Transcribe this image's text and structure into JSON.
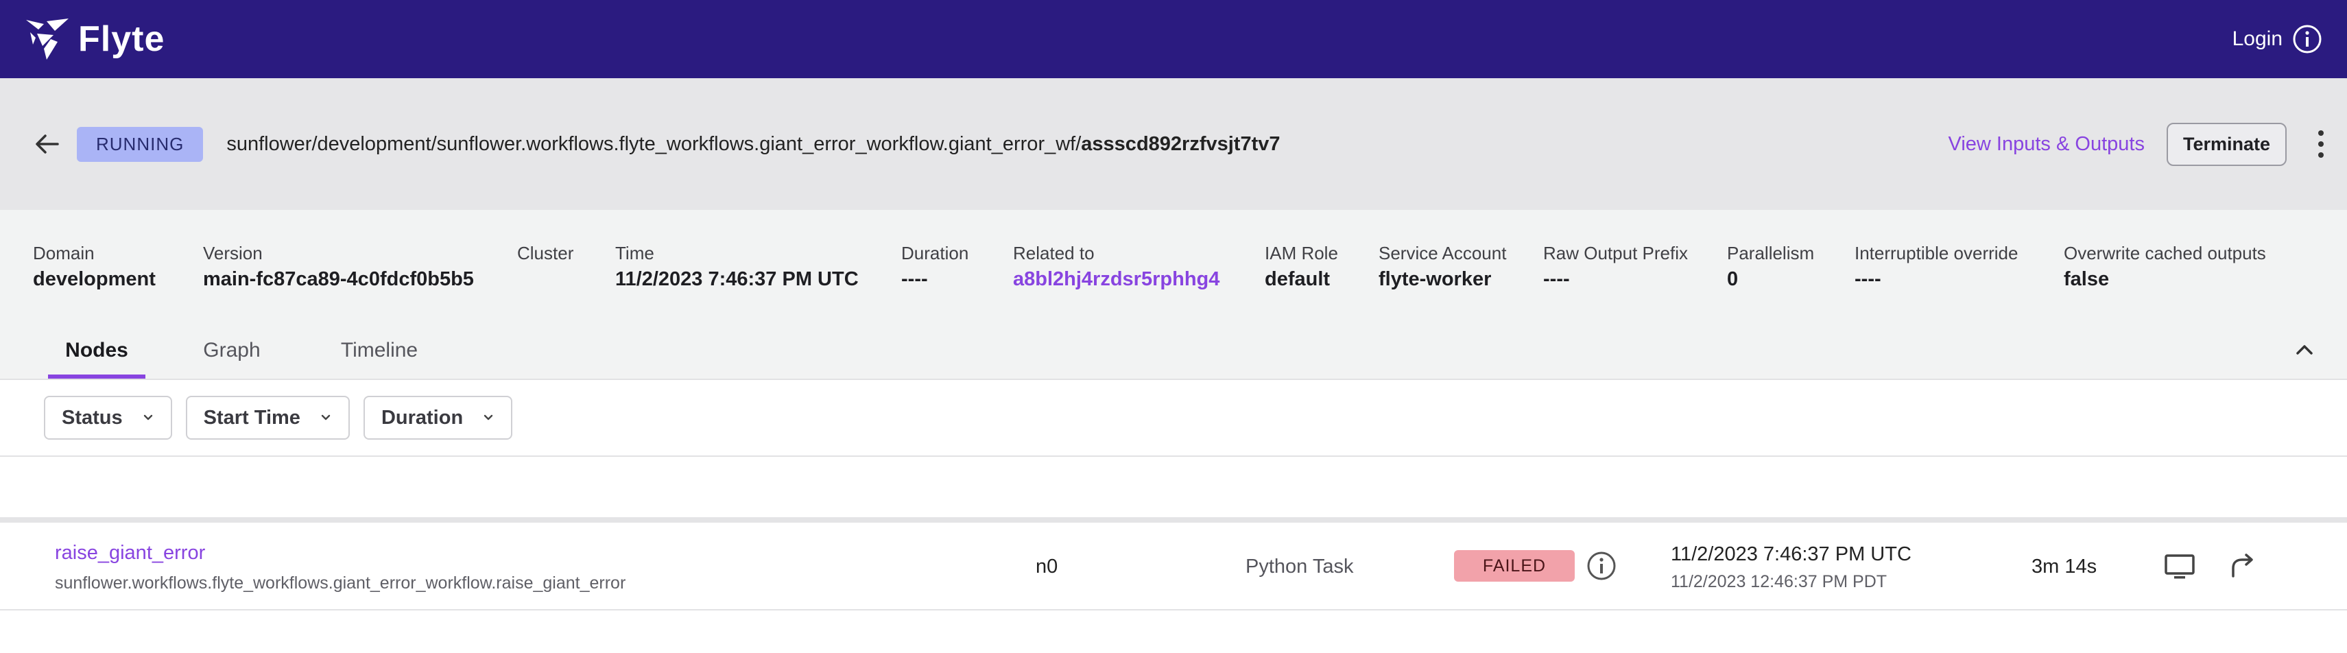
{
  "app": {
    "brand_name": "Flyte",
    "login_label": "Login"
  },
  "execution": {
    "status": "RUNNING",
    "path": "sunflower/development/sunflower.workflows.flyte_workflows.giant_error_workflow.giant_error_wf/",
    "id": "assscd892rzfvsjt7tv7",
    "view_io_label": "View Inputs & Outputs",
    "terminate_label": "Terminate"
  },
  "details": [
    {
      "label": "Domain",
      "value": "development"
    },
    {
      "label": "Version",
      "value": "main-fc87ca89-4c0fdcf0b5b5"
    },
    {
      "label": "Cluster",
      "value": ""
    },
    {
      "label": "Time",
      "value": "11/2/2023 7:46:37 PM UTC"
    },
    {
      "label": "Duration",
      "value": "----"
    },
    {
      "label": "Related to",
      "value": "a8bl2hj4rzdsr5rphhg4"
    },
    {
      "label": "IAM Role",
      "value": "default"
    },
    {
      "label": "Service Account",
      "value": "flyte-worker"
    },
    {
      "label": "Raw Output Prefix",
      "value": "----"
    },
    {
      "label": "Parallelism",
      "value": "0"
    },
    {
      "label": "Interruptible override",
      "value": "----"
    },
    {
      "label": "Overwrite cached outputs",
      "value": "false"
    }
  ],
  "tabs": [
    {
      "label": "Nodes",
      "active": true
    },
    {
      "label": "Graph",
      "active": false
    },
    {
      "label": "Timeline",
      "active": false
    }
  ],
  "filters": [
    {
      "label": "Status"
    },
    {
      "label": "Start Time"
    },
    {
      "label": "Duration"
    }
  ],
  "nodes": [
    {
      "name": "raise_giant_error",
      "full_name": "sunflower.workflows.flyte_workflows.giant_error_workflow.raise_giant_error",
      "node_id": "n0",
      "type": "Python Task",
      "status": "FAILED",
      "start_time_utc": "11/2/2023 7:46:37 PM UTC",
      "start_time_local": "11/2/2023 12:46:37 PM PDT",
      "duration": "3m 14s"
    }
  ],
  "colors": {
    "topbar": "#2b1b80",
    "accent": "#8844e0",
    "running": "#aab4f6",
    "failed": "#f2a2aa"
  },
  "icons": {
    "logo": "flyte-logo-icon",
    "info": "info-icon",
    "back": "arrow-back-icon",
    "more": "more-vertical-icon",
    "collapse": "chevron-up-icon",
    "dropdown": "chevron-down-icon",
    "logs": "monitor-icon",
    "rerun": "rerun-icon"
  }
}
